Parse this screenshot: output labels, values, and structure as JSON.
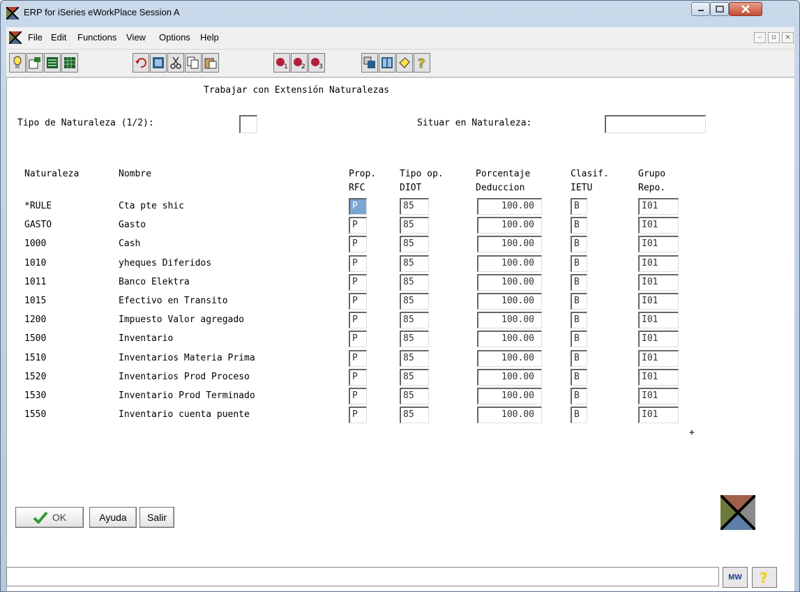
{
  "window": {
    "title": "ERP for iSeries eWorkPlace Session A"
  },
  "menu": {
    "items": [
      "File",
      "Edit",
      "Functions",
      "View",
      "Options",
      "Help"
    ]
  },
  "screen": {
    "title": "Trabajar con Extensión Naturalezas",
    "tipo_label": "Tipo de Naturaleza (1/2):",
    "tipo_value": "",
    "situar_label": "Situar en Naturaleza:",
    "situar_value": "",
    "headers": {
      "naturaleza": "Naturaleza",
      "nombre": "Nombre",
      "prop_1": "Prop.",
      "prop_2": "RFC",
      "tipo_1": "Tipo op.",
      "tipo_2": "DIOT",
      "porc_1": "Porcentaje",
      "porc_2": "Deduccion",
      "clasif_1": "Clasif.",
      "clasif_2": "IETU",
      "grupo_1": "Grupo",
      "grupo_2": "Repo."
    },
    "rows": [
      {
        "naturaleza": "*RULE",
        "nombre": "Cta pte shic",
        "prop": "P",
        "tipo": "85",
        "porcentaje": "100.00",
        "clasif": "B",
        "grupo": "I01"
      },
      {
        "naturaleza": "GASTO",
        "nombre": "Gasto",
        "prop": "P",
        "tipo": "85",
        "porcentaje": "100.00",
        "clasif": "B",
        "grupo": "I01"
      },
      {
        "naturaleza": "1000",
        "nombre": "Cash",
        "prop": "P",
        "tipo": "85",
        "porcentaje": "100.00",
        "clasif": "B",
        "grupo": "I01"
      },
      {
        "naturaleza": "1010",
        "nombre": "yheques Diferidos",
        "prop": "P",
        "tipo": "85",
        "porcentaje": "100.00",
        "clasif": "B",
        "grupo": "I01"
      },
      {
        "naturaleza": "1011",
        "nombre": "Banco Elektra",
        "prop": "P",
        "tipo": "85",
        "porcentaje": "100.00",
        "clasif": "B",
        "grupo": "I01"
      },
      {
        "naturaleza": "1015",
        "nombre": "Efectivo en Transito",
        "prop": "P",
        "tipo": "85",
        "porcentaje": "100.00",
        "clasif": "B",
        "grupo": "I01"
      },
      {
        "naturaleza": "1200",
        "nombre": "Impuesto Valor agregado",
        "prop": "P",
        "tipo": "85",
        "porcentaje": "100.00",
        "clasif": "B",
        "grupo": "I01"
      },
      {
        "naturaleza": "1500",
        "nombre": "Inventario",
        "prop": "P",
        "tipo": "85",
        "porcentaje": "100.00",
        "clasif": "B",
        "grupo": "I01"
      },
      {
        "naturaleza": "1510",
        "nombre": "Inventarios Materia Prima",
        "prop": "P",
        "tipo": "85",
        "porcentaje": "100.00",
        "clasif": "B",
        "grupo": "I01"
      },
      {
        "naturaleza": "1520",
        "nombre": "Inventarios Prod Proceso",
        "prop": "P",
        "tipo": "85",
        "porcentaje": "100.00",
        "clasif": "B",
        "grupo": "I01"
      },
      {
        "naturaleza": "1530",
        "nombre": "Inventario Prod Terminado",
        "prop": "P",
        "tipo": "85",
        "porcentaje": "100.00",
        "clasif": "B",
        "grupo": "I01"
      },
      {
        "naturaleza": "1550",
        "nombre": "Inventario cuenta puente",
        "prop": "P",
        "tipo": "85",
        "porcentaje": "100.00",
        "clasif": "B",
        "grupo": "I01"
      }
    ],
    "more_indicator": "+"
  },
  "buttons": {
    "ok": "OK",
    "ayuda": "Ayuda",
    "salir": "Salir"
  },
  "statusbar": {
    "text": "",
    "mw_label": "MW",
    "help_label": "?"
  },
  "colors": {
    "selection": "#7aa6d6",
    "titlebar": "#c9d9ea",
    "close": "#c44a32"
  }
}
